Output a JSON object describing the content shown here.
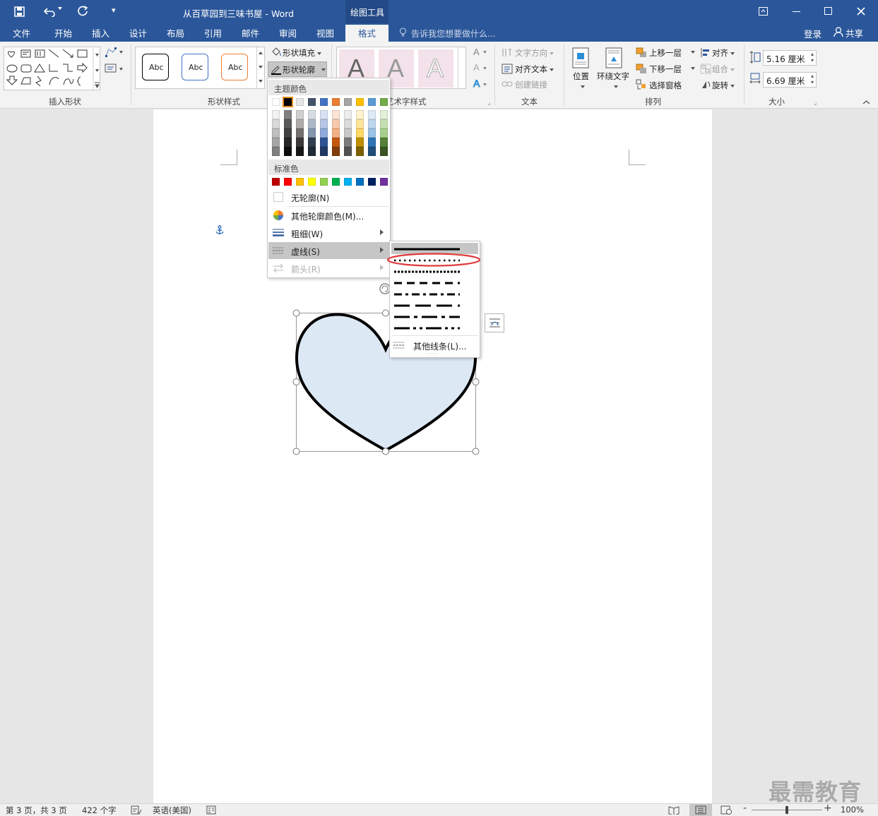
{
  "title_bar": {
    "document_title": "从百草园到三味书屋 - Word",
    "context_tab": "绘图工具",
    "controls": [
      "minimize-icon",
      "restore-icon",
      "close-icon"
    ]
  },
  "tabs": [
    "文件",
    "开始",
    "插入",
    "设计",
    "布局",
    "引用",
    "邮件",
    "审阅",
    "视图",
    "格式"
  ],
  "active_tab": "格式",
  "tell_me": "告诉我您想要做什么...",
  "account": {
    "login": "登录",
    "share": "共享"
  },
  "ribbon": {
    "groups": {
      "insert_shapes": "插入形状",
      "shape_styles": "形状样式",
      "wordart_styles": "艺术字样式",
      "text": "文本",
      "arrange": "排列",
      "size": "大小"
    },
    "style_samples": [
      "Abc",
      "Abc",
      "Abc"
    ],
    "shape_fill": "形状填充",
    "shape_outline": "形状轮廓",
    "wordart_letters": [
      "A",
      "A",
      "A"
    ],
    "text_direction": "文字方向",
    "align_text": "对齐文本",
    "create_link": "创建链接",
    "position": "位置",
    "wrap_text": "环绕文字",
    "bring_forward": "上移一层",
    "send_backward": "下移一层",
    "selection_pane": "选择窗格",
    "align": "对齐",
    "group": "组合",
    "rotate": "旋转",
    "height": "5.16 厘米",
    "width": "6.69 厘米"
  },
  "outline_menu": {
    "theme_colors_header": "主题颜色",
    "standard_colors_header": "标准色",
    "no_outline": "无轮廓(N)",
    "more_colors": "其他轮廓颜色(M)...",
    "weight": "粗细(W)",
    "dashes": "虚线(S)",
    "arrows": "箭头(R)",
    "theme_top": [
      "#ffffff",
      "#000000",
      "#e7e6e6",
      "#44546a",
      "#4472c4",
      "#ed7d31",
      "#a5a5a5",
      "#ffc000",
      "#5b9bd5",
      "#70ad47"
    ],
    "theme_shades": [
      [
        "#f2f2f2",
        "#808080",
        "#d0cece",
        "#d6dce4",
        "#d9e2f3",
        "#fbe4d5",
        "#ededed",
        "#fff2cc",
        "#deebf6",
        "#e2efd9"
      ],
      [
        "#d9d9d9",
        "#595959",
        "#aeabab",
        "#adb9ca",
        "#b4c6e7",
        "#f7caac",
        "#dbdbdb",
        "#fee599",
        "#bdd7ee",
        "#c5e0b3"
      ],
      [
        "#bfbfbf",
        "#404040",
        "#757070",
        "#8496b0",
        "#8eaadb",
        "#f4b083",
        "#c9c9c9",
        "#ffd965",
        "#9cc3e5",
        "#a8d08d"
      ],
      [
        "#a6a6a6",
        "#262626",
        "#3a3838",
        "#323f4f",
        "#2f5496",
        "#c45911",
        "#7b7b7b",
        "#bf9000",
        "#2e75b5",
        "#538135"
      ],
      [
        "#7f7f7f",
        "#0d0d0d",
        "#171616",
        "#222a35",
        "#1f3864",
        "#833c0b",
        "#525252",
        "#7f6000",
        "#1e4e79",
        "#375623"
      ]
    ],
    "standard": [
      "#c00000",
      "#ff0000",
      "#ffc000",
      "#ffff00",
      "#92d050",
      "#00b050",
      "#00b0f0",
      "#0070c0",
      "#002060",
      "#7030a0"
    ]
  },
  "dash_menu": {
    "more_lines": "其他线条(L)...",
    "highlight_color": "#e03a3a"
  },
  "status": {
    "page": "第 3 页，共 3 页",
    "words": "422 个字",
    "language": "英语(美国)",
    "zoom": "100%",
    "zoom_level": 1.0
  },
  "watermark": "最需教育",
  "colors": {
    "accent": "#2b579a",
    "heart_fill": "#dde8f5",
    "anchor": "#2f6ab8"
  }
}
